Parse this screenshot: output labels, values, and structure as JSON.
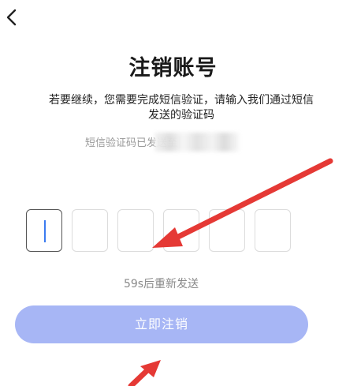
{
  "header": {
    "back_icon": "chevron-left-icon"
  },
  "page": {
    "title": "注销账号",
    "description": "若要继续，您需要完成短信验证，请输入我们通过短信发送的验证码",
    "sent_to_label": "短信验证码已发送至",
    "resend_countdown": "59s后重新发送",
    "confirm_button": "立即注销"
  },
  "otp": {
    "box_count": 6,
    "active_index": 0
  },
  "colors": {
    "title": "#1a1a1a",
    "button_bg": "#a7b6f5",
    "button_text": "#ffffff",
    "muted_text": "#8a8a8a",
    "caret": "#3b7bf0",
    "annotation_arrow": "#e53935"
  }
}
